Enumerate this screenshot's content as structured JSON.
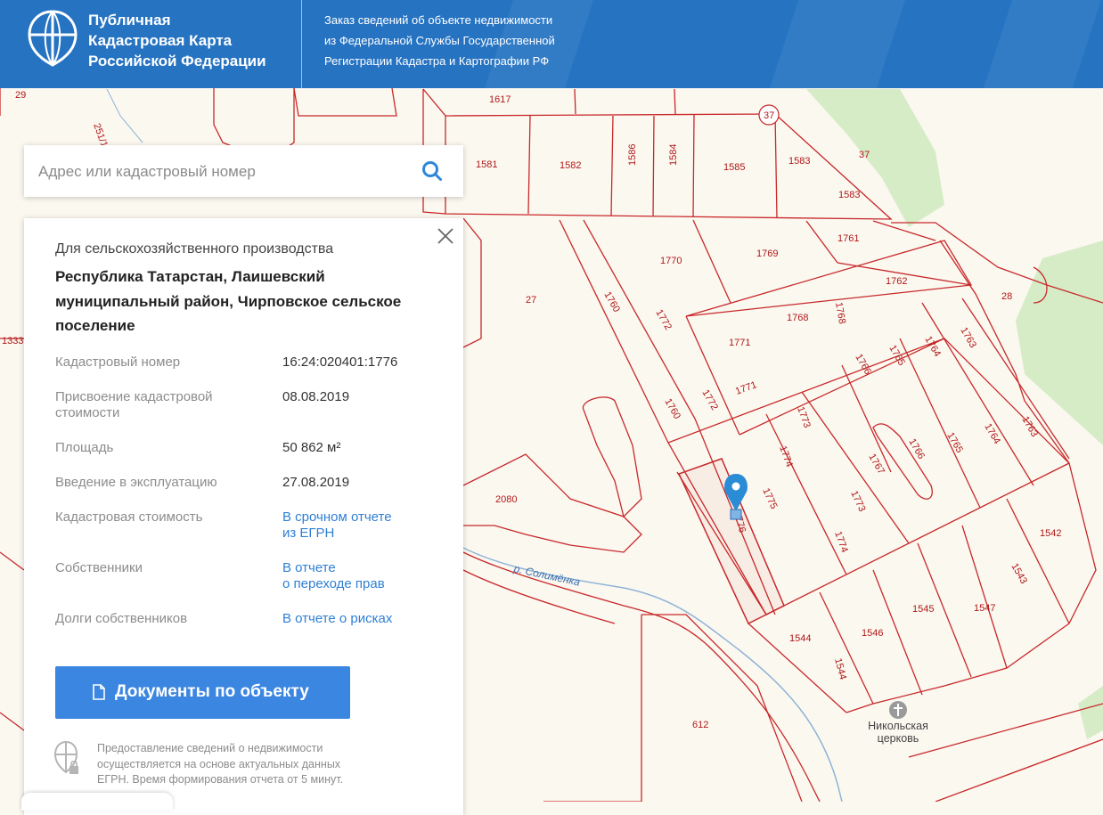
{
  "header": {
    "brand_line1": "Публичная",
    "brand_line2": "Кадастровая Карта",
    "brand_line3": "Российской Федерации",
    "sub_line1": "Заказ сведений об объекте недвижимости",
    "sub_line2": "из Федеральной Службы Государственной",
    "sub_line3": "Регистрации Кадастра и Картографии РФ",
    "color": "#2673c2"
  },
  "search": {
    "placeholder": "Адрес или кадастровый номер",
    "value": ""
  },
  "panel": {
    "category": "Для сельскохозяйственного производства",
    "address_line1": "Республика Татарстан, Лаишевский",
    "address_line2": "муниципальный район, Чирповское сельское",
    "address_line3": "поселение",
    "fields": [
      {
        "label": "Кадастровый номер",
        "value": "16:24:020401:1776"
      },
      {
        "label_line1": "Присвоение кадастровой",
        "label_line2": "стоимости",
        "value": "08.08.2019"
      },
      {
        "label": "Площадь",
        "value": "50 862 м²"
      },
      {
        "label": "Введение в эксплуатацию",
        "value": "27.08.2019"
      },
      {
        "label": "Кадастровая стоимость",
        "value_line1": "В срочном отчете",
        "value_line2": "из ЕГРН"
      },
      {
        "label": "Собственники",
        "value_line1": "В отчете",
        "value_line2": "о переходе прав"
      },
      {
        "label": "Долги собственников",
        "value": "В отчете о рисках"
      }
    ],
    "button_label": "Документы по объекту",
    "note_line1": "Предоставление сведений о недвижимости",
    "note_line2": "осуществляется на основе актуальных данных",
    "note_line3": "ЕГРН. Время формирования отчета от 5 минут.",
    "link_color": "#2f7fd4",
    "button_color": "#3b86e0"
  },
  "map": {
    "parcel_labels": [
      "29",
      "251/1",
      "1617",
      "37",
      "1581",
      "1582",
      "1586",
      "1584",
      "1585",
      "1583",
      "37",
      "1583",
      "1770",
      "1769",
      "1761",
      "1762",
      "28",
      "27",
      "1760",
      "1772",
      "1768",
      "1768",
      "1771",
      "1763",
      "1764",
      "1765",
      "1766",
      "1333",
      "1772",
      "1771",
      "1773",
      "1760",
      "1763",
      "1764",
      "1765",
      "1766",
      "1767",
      "1774",
      "1775",
      "1776",
      "1773",
      "2080",
      "1774",
      "1542",
      "1543",
      "1544",
      "1546",
      "1545",
      "1547",
      "1544",
      "612"
    ],
    "river_label": "р. Солимёнка",
    "church_line1": "Никольская",
    "church_line2": "церковь",
    "line_color": "#c8282a",
    "green_color": "#d6ecc6",
    "marker_color": "#2b8cd6"
  }
}
